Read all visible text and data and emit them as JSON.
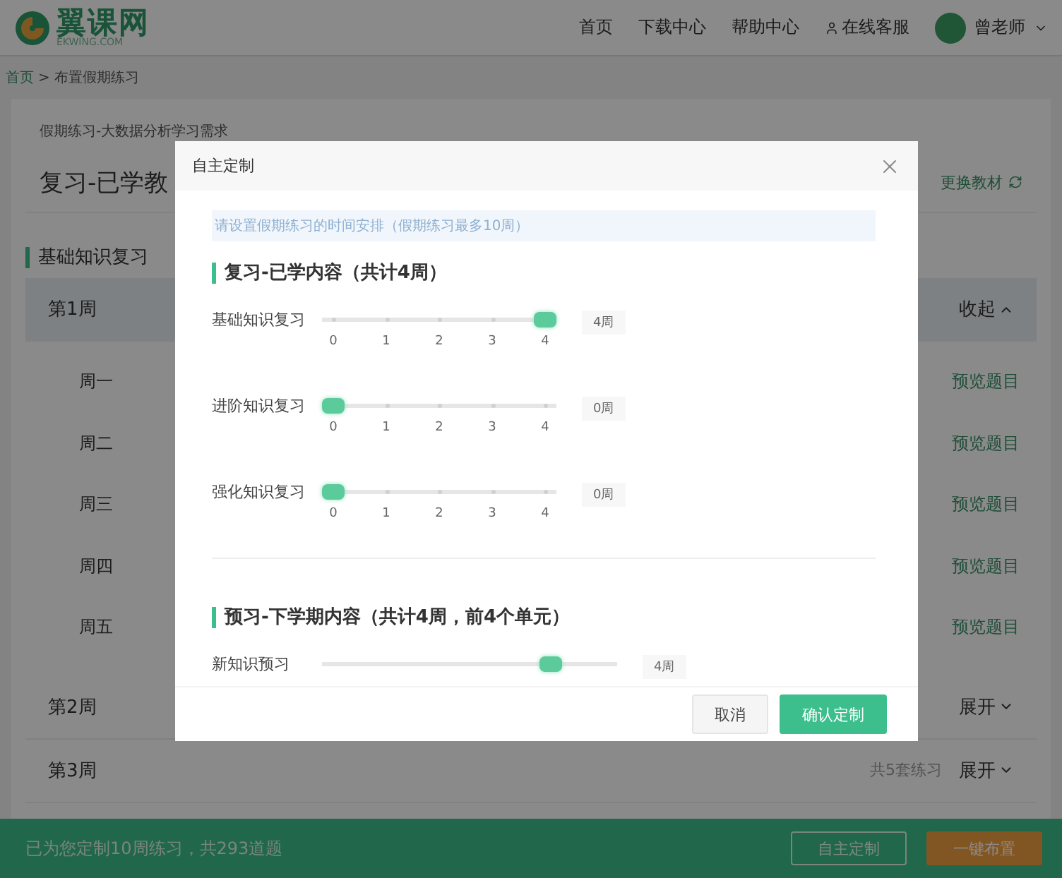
{
  "header": {
    "logo": {
      "name": "翼课网",
      "domain": "EKWING.COM"
    },
    "nav": [
      {
        "label": "首页"
      },
      {
        "label": "下载中心"
      },
      {
        "label": "帮助中心"
      },
      {
        "label": "在线客服",
        "kind": "service"
      }
    ],
    "user": {
      "name": "曾老师"
    }
  },
  "breadcrumb": {
    "items": [
      "首页",
      "布置假期练习"
    ],
    "separator": ">"
  },
  "intro": "假期练习-大数据分析学习需求",
  "plan": {
    "title": "复习-已学教",
    "change_textbook": "更换教材",
    "section": "基础知识复习",
    "weeks": [
      {
        "label": "第1周",
        "expanded": true,
        "toggle": "收起",
        "days": [
          {
            "label": "周一",
            "action": "预览题目"
          },
          {
            "label": "周二",
            "action": "预览题目"
          },
          {
            "label": "周三",
            "action": "预览题目"
          },
          {
            "label": "周四",
            "action": "预览题目"
          },
          {
            "label": "周五",
            "action": "预览题目"
          }
        ]
      },
      {
        "label": "第2周",
        "expanded": false,
        "toggle": "展开"
      },
      {
        "label": "第3周",
        "expanded": false,
        "toggle": "展开",
        "summary": "共5套练习"
      }
    ]
  },
  "footer_bar": {
    "summary": "已为您定制10周练习，共293道题",
    "buttons": [
      {
        "label": "自主定制",
        "kind": "outline"
      },
      {
        "label": "一键布置",
        "kind": "primary"
      }
    ]
  },
  "dialog": {
    "title": "自主定制",
    "notice": "请设置假期练习的时间安排（假期练习最多10周）",
    "groups": [
      {
        "title": "复习-已学内容（共计4周）",
        "sliders": [
          {
            "label": "基础知识复习",
            "level": 1,
            "reading": "4周",
            "ticks": [
              "0",
              "1",
              "2",
              "3",
              "4"
            ]
          },
          {
            "label": "进阶知识复习",
            "level": 0,
            "reading": "0周",
            "ticks": [
              "0",
              "1",
              "2",
              "3",
              "4"
            ]
          },
          {
            "label": "强化知识复习",
            "level": 0,
            "reading": "0周",
            "ticks": [
              "0",
              "1",
              "2",
              "3",
              "4"
            ]
          }
        ]
      },
      {
        "title": "预习-下学期内容（共计4周，前4个单元）",
        "sliders": [
          {
            "label": "新知识预习",
            "level": 0.8,
            "reading": "4周"
          }
        ]
      }
    ],
    "buttons": [
      {
        "label": "取消",
        "kind": "secondary"
      },
      {
        "label": "确认定制",
        "kind": "primary"
      }
    ]
  }
}
